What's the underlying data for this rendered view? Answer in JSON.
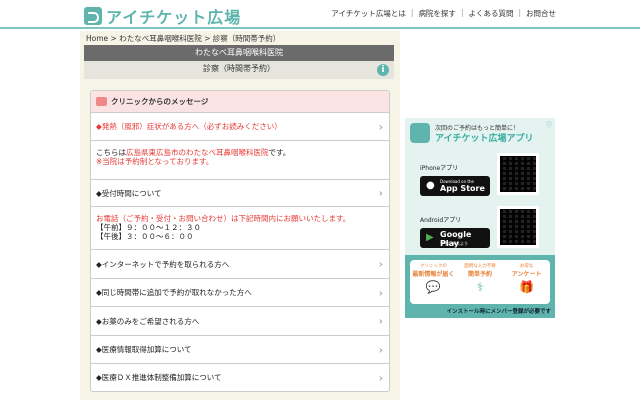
{
  "header": {
    "logo": "アイチケット広場",
    "nav": [
      "アイチケット広場とは",
      "病院を探す",
      "よくある質問",
      "お問合せ"
    ]
  },
  "breadcrumb": "Home > わたなべ耳鼻咽喉科医院 > 診察（時間帯予約）",
  "clinic_name": "わたなべ耳鼻咽喉科医院",
  "service": "診察（時間帯予約）",
  "messages": {
    "title": "クリニックからのメッセージ",
    "fever": "◆発熱（風邪）症状がある方へ（必ずお読みください）",
    "intro_pre": "こちらは",
    "intro_link": "広島県東広島市のわたなべ耳鼻咽喉科医院",
    "intro_post": "です。",
    "intro_note": "※当院は予約制となっております。",
    "reception": "◆受付時間について",
    "phone": "お電話（ご予約・受付・お問い合わせ）は下記時間内にお願いいたします。",
    "am": "【午前】９：００〜１２：３０",
    "pm": "【午後】３：００〜６：００",
    "items": [
      "◆インターネットで予約を取られる方へ",
      "◆同じ時間帯に追加で予約が取れなかった方へ",
      "◆お薬のみをご希望される方へ",
      "◆医療情報取得加算について",
      "◆医療ＤＸ推進体制整備加算について"
    ]
  },
  "banner": {
    "tagline": "次回のご予約はもっと簡単に！",
    "title": "アイチケット広場アプリ",
    "iphone": "iPhoneアプリ",
    "appstore_small": "Download on the",
    "appstore": "App Store",
    "android": "Androidアプリ",
    "gplay": "Google Play",
    "gplay_small": "で手に入れよう",
    "features": [
      {
        "sub": "クリニックの",
        "main": "最新情報が届く"
      },
      {
        "sub": "面倒な入力不要",
        "main": "簡単予約"
      },
      {
        "sub": "お得な",
        "main": "アンケート"
      }
    ],
    "note": "インストール時にメンバー登録が必要です"
  }
}
